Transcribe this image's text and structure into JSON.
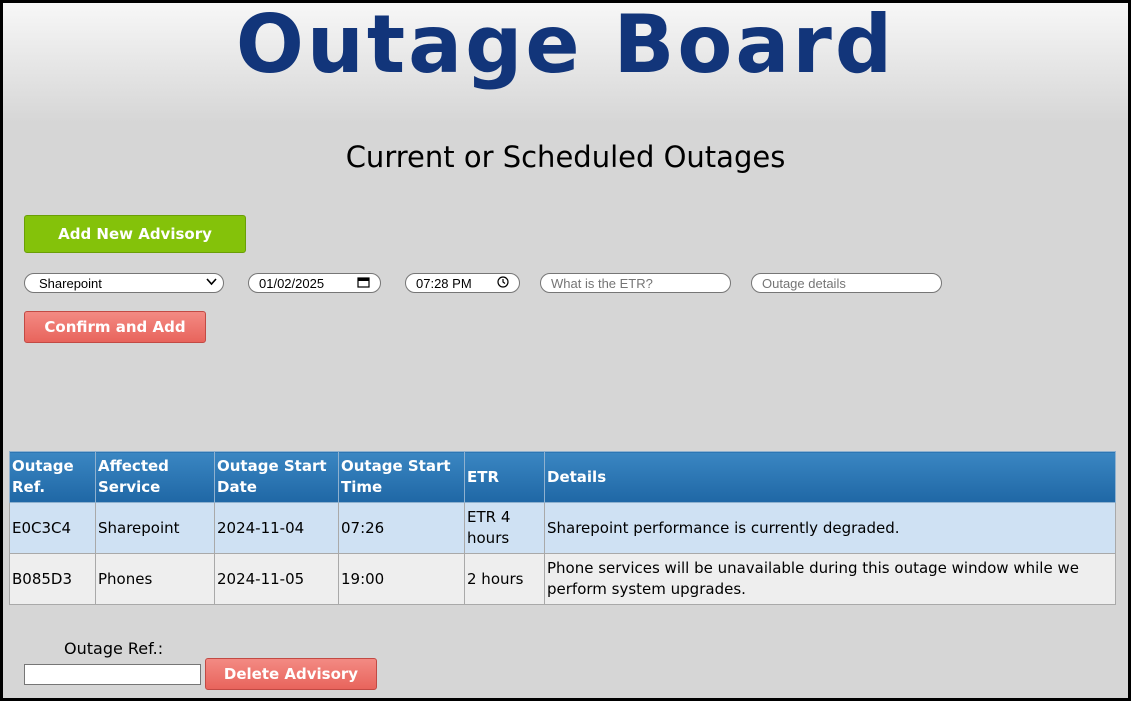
{
  "header": {
    "app_title": "Outage Board",
    "section_title": "Current or Scheduled Outages"
  },
  "form": {
    "add_button_label": "Add New Advisory",
    "service_select": {
      "selected": "Sharepoint",
      "icon": "chevron-down-icon"
    },
    "date_input": {
      "value": "01/02/2025",
      "icon": "calendar-icon"
    },
    "time_input": {
      "value": "07:28 PM",
      "icon": "clock-icon"
    },
    "etr_input": {
      "placeholder": "What is the ETR?"
    },
    "details_input": {
      "placeholder": "Outage details"
    },
    "confirm_button_label": "Confirm and Add"
  },
  "table": {
    "headers": [
      "Outage Ref.",
      "Affected Service",
      "Outage Start Date",
      "Outage Start Time",
      "ETR",
      "Details"
    ],
    "rows": [
      {
        "ref": "E0C3C4",
        "service": "Sharepoint",
        "start_date": "2024-11-04",
        "start_time": "07:26",
        "etr": "ETR 4 hours",
        "details": "Sharepoint performance is currently degraded."
      },
      {
        "ref": "B085D3",
        "service": "Phones",
        "start_date": "2024-11-05",
        "start_time": "19:00",
        "etr": "2 hours",
        "details": "Phone services will be unavailable during this outage window while we perform system upgrades."
      }
    ]
  },
  "delete_form": {
    "ref_label": "Outage Ref.:",
    "ref_value": "",
    "delete_button_label": "Delete Advisory"
  },
  "colors": {
    "title": "#12357a",
    "add_button": "#84c20a",
    "danger_button": "#e8645c",
    "table_header": "#1f67a5",
    "row_highlight": "#cfe1f3"
  }
}
